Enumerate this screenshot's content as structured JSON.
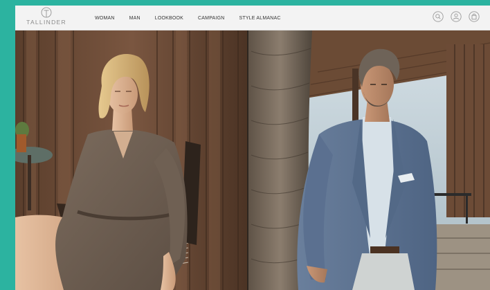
{
  "brand": {
    "name": "TALLINDER"
  },
  "nav": {
    "items": [
      {
        "label": "WOMAN"
      },
      {
        "label": "MAN"
      },
      {
        "label": "LOOKBOOK"
      },
      {
        "label": "CAMPAIGN"
      },
      {
        "label": "STYLE ALMANAC"
      }
    ]
  },
  "header_icons": [
    {
      "name": "search-icon"
    },
    {
      "name": "user-icon"
    },
    {
      "name": "shopping-bag-icon"
    }
  ],
  "colors": {
    "background_accent": "#2cb3a0",
    "header_bg": "#f3f3f3",
    "nav_text": "#333333",
    "logo_text": "#8a8a8a"
  },
  "hero": {
    "panels": [
      {
        "name": "woman-campaign-photo",
        "description_visible": false
      },
      {
        "name": "man-campaign-photo",
        "description_visible": false
      }
    ]
  }
}
